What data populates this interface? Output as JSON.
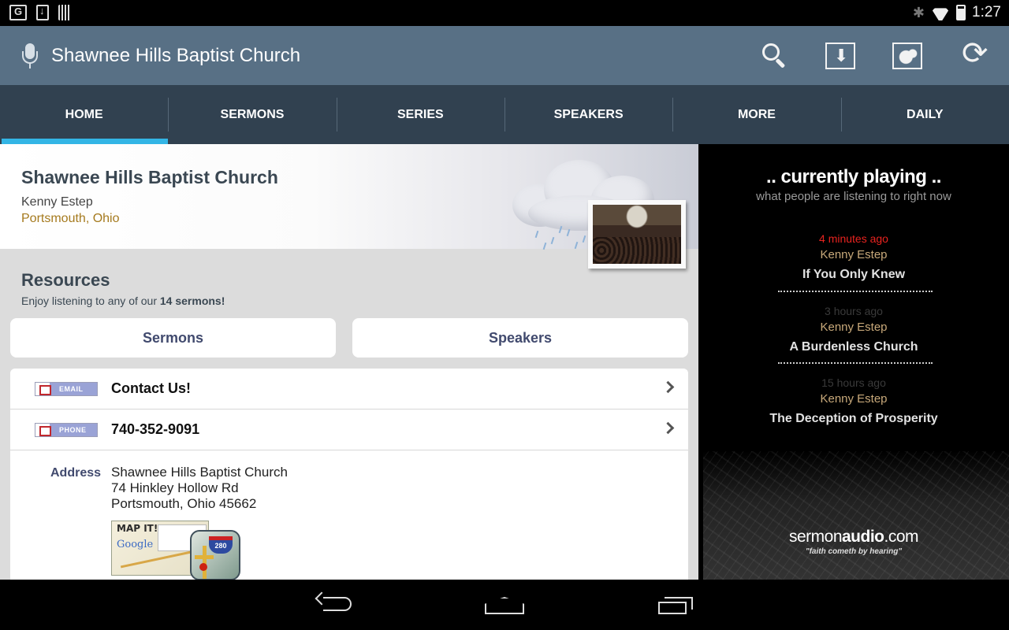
{
  "status_bar": {
    "time": "1:27"
  },
  "action_bar": {
    "title": "Shawnee Hills Baptist Church"
  },
  "tabs": [
    {
      "label": "HOME",
      "active": true
    },
    {
      "label": "SERMONS"
    },
    {
      "label": "SERIES"
    },
    {
      "label": "SPEAKERS"
    },
    {
      "label": "MORE"
    },
    {
      "label": "DAILY"
    }
  ],
  "header": {
    "church_name": "Shawnee Hills Baptist Church",
    "pastor": "Kenny Estep",
    "location": "Portsmouth, Ohio"
  },
  "resources": {
    "title": "Resources",
    "subtitle_prefix": "Enjoy listening to any of our ",
    "subtitle_count": "14 sermons!",
    "buttons": {
      "sermons": "Sermons",
      "speakers": "Speakers"
    }
  },
  "contact": {
    "email_badge": "EMAIL",
    "email_label": "Contact Us!",
    "phone_badge": "PHONE",
    "phone_label": "740-352-9091",
    "address_label": "Address",
    "address_lines": [
      "Shawnee Hills Baptist Church",
      "74 Hinkley Hollow Rd",
      "Portsmouth, Ohio 45662"
    ],
    "map_title": "MAP IT!",
    "map_brand": "Google",
    "route_number": "280"
  },
  "now_playing": {
    "title": ".. currently playing ..",
    "subtitle": "what people are listening to right now",
    "items": [
      {
        "time": "4 minutes ago",
        "speaker": "Kenny Estep",
        "sermon": "If You Only Knew",
        "time_color": "#e8231f"
      },
      {
        "time": "3 hours ago",
        "speaker": "Kenny Estep",
        "sermon": "A Burdenless Church",
        "time_color": "#3a3a3a"
      },
      {
        "time": "15 hours ago",
        "speaker": "Kenny Estep",
        "sermon": "The Deception of Prosperity",
        "time_color": "#3a3a3a"
      }
    ],
    "brand_prefix": "sermon",
    "brand_bold": "audio",
    "brand_suffix": ".com",
    "tagline": "\"faith cometh by hearing\""
  },
  "colors": {
    "accent": "#33b5e5",
    "action_bar": "#587085",
    "tab_bar": "#314150"
  }
}
